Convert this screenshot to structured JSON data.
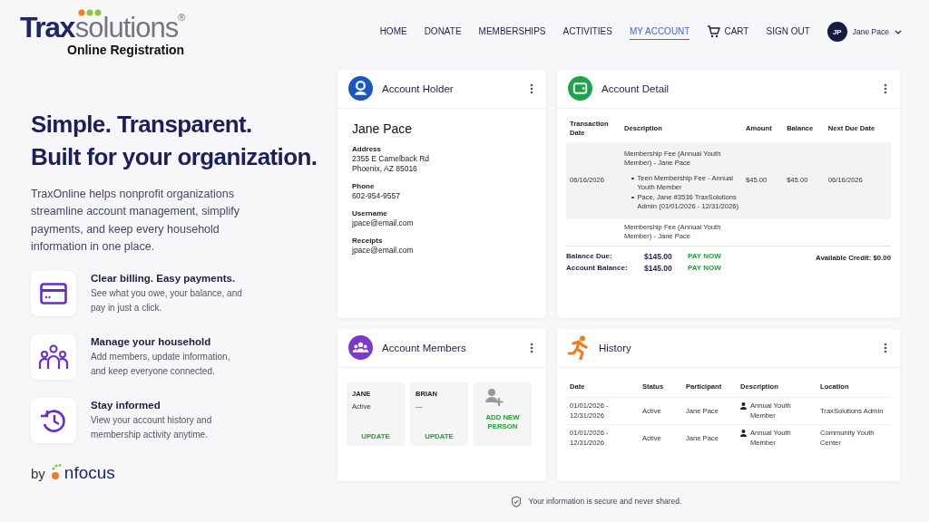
{
  "brand": {
    "name_bold": "Trax",
    "name_light": "solutions",
    "mark": "®",
    "subtitle": "Online Registration"
  },
  "nav": {
    "items": [
      {
        "label": "HOME",
        "kind": "link",
        "selected": false
      },
      {
        "label": "DONATE",
        "kind": "link",
        "selected": false
      },
      {
        "label": "MEMBERSHIPS",
        "kind": "link",
        "selected": false
      },
      {
        "label": "ACTIVITIES",
        "kind": "link",
        "selected": false
      },
      {
        "label": "MY ACCOUNT",
        "kind": "link",
        "selected": true
      },
      {
        "label": "CART",
        "kind": "cart",
        "selected": false
      },
      {
        "label": "SIGN OUT",
        "kind": "link",
        "selected": false
      }
    ],
    "user": {
      "initials": "JP",
      "name": "Jane Pace"
    }
  },
  "hero": {
    "headline": [
      "Simple. Transparent.",
      "Built for your organization."
    ],
    "intro": "TraxOnline helps nonprofit organizations streamline account management, simplify payments, and keep every household information in one place.",
    "features": [
      {
        "kind": "billing",
        "title": "Clear billing. Easy payments.",
        "text": "See what you owe, your balance, and pay in just a click."
      },
      {
        "kind": "household",
        "title": "Manage your household",
        "text": "Add members, update information, and keep everyone connected."
      },
      {
        "kind": "history",
        "title": "Stay informed",
        "text": "View your account history and membership activity anytime."
      }
    ],
    "byline": {
      "by": "by",
      "brand": "nfocus"
    }
  },
  "account_holder": {
    "title": "Account Holder",
    "name": "Jane Pace",
    "fields": [
      {
        "label": "Address",
        "lines": [
          "2355 E Camelback Rd",
          "Phoenix, AZ 85016"
        ]
      },
      {
        "label": "Phone",
        "lines": [
          "602-954-9557"
        ]
      },
      {
        "label": "Username",
        "lines": [
          "jpace@email.com"
        ]
      },
      {
        "label": "Receipts",
        "lines": [
          "jpace@email.com"
        ]
      }
    ]
  },
  "account_detail": {
    "title": "Account Detail",
    "columns": [
      "Transaction Date",
      "Description",
      "Amount",
      "Balance",
      "Next Due Date"
    ],
    "rows": [
      {
        "date": "06/16/2026",
        "description": "Membership Fee (Annual Youth Member) - Jane Pace",
        "items": [
          "Teen Membership Fee - Annual Youth Member",
          "Pace, Jane #3536 TraxSolutions Admin (01/01/2026 - 12/31/2026)"
        ],
        "amount": "$45.00",
        "balance": "$45.00",
        "next_due": "06/16/2026"
      },
      {
        "description": "Membership Fee (Annual Youth Member) - Jane Pace"
      }
    ],
    "summary": [
      {
        "label": "Balance Due:",
        "amount": "$145.00",
        "action": "PAY NOW"
      },
      {
        "label": "Account Balance:",
        "amount": "$145.00",
        "action": "PAY NOW"
      }
    ],
    "credit": "Available Credit: $0.00"
  },
  "account_members": {
    "title": "Account Members",
    "members": [
      {
        "name": "JANE",
        "status": "Active",
        "action": "UPDATE"
      },
      {
        "name": "BRIAN",
        "status": "---",
        "action": "UPDATE"
      }
    ],
    "add": "ADD NEW PERSON"
  },
  "history": {
    "title": "History",
    "columns": [
      "Date",
      "Status",
      "Participant",
      "Description",
      "Location"
    ],
    "rows": [
      {
        "date": "01/01/2026 - 12/31/2026",
        "status": "Active",
        "participant": "Jane Pace",
        "description": "Annual Youth Member",
        "location": "TraxSolutions Admin"
      },
      {
        "date": "01/01/2026 - 12/31/2026",
        "status": "Active",
        "participant": "Jane Pace",
        "description": "Annual Youth Member",
        "location": "Community Youth Center"
      }
    ]
  },
  "footer": {
    "text": "Your information is secure and never shared."
  }
}
